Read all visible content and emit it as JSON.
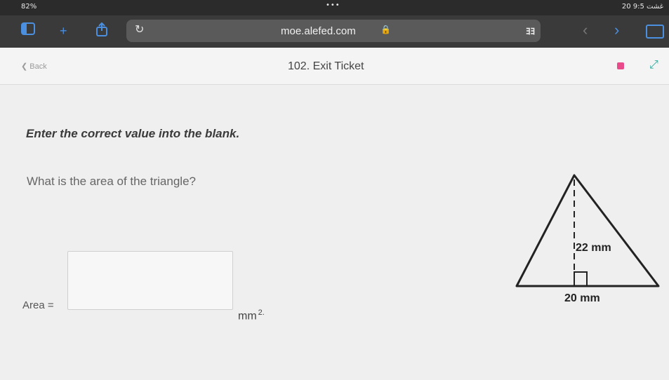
{
  "status_bar": {
    "battery": "82%",
    "center": "•••",
    "time": "20 غشت 9:5"
  },
  "browser": {
    "url": "moe.alefed.com",
    "reader_label": "ﾖﾖ",
    "icons": [
      "sidebar-icon",
      "add-icon",
      "share-icon",
      "reload-icon",
      "lock-icon",
      "back-chevron-icon",
      "forward-chevron-icon",
      "tabs-icon"
    ]
  },
  "app_header": {
    "back_label": "Back",
    "title": "102. Exit Ticket"
  },
  "question": {
    "instruction": "Enter the correct value into the blank.",
    "prompt": "What is the area of the triangle?",
    "area_label": "Area =",
    "answer_value": "",
    "unit": "mm",
    "unit_exp": "2."
  },
  "figure": {
    "height_label": "22 mm",
    "base_label": "20 mm"
  },
  "colors": {
    "accent_blue": "#4a8fe0",
    "flag_pink": "#e84a8a",
    "expand_teal": "#2aa89a"
  }
}
